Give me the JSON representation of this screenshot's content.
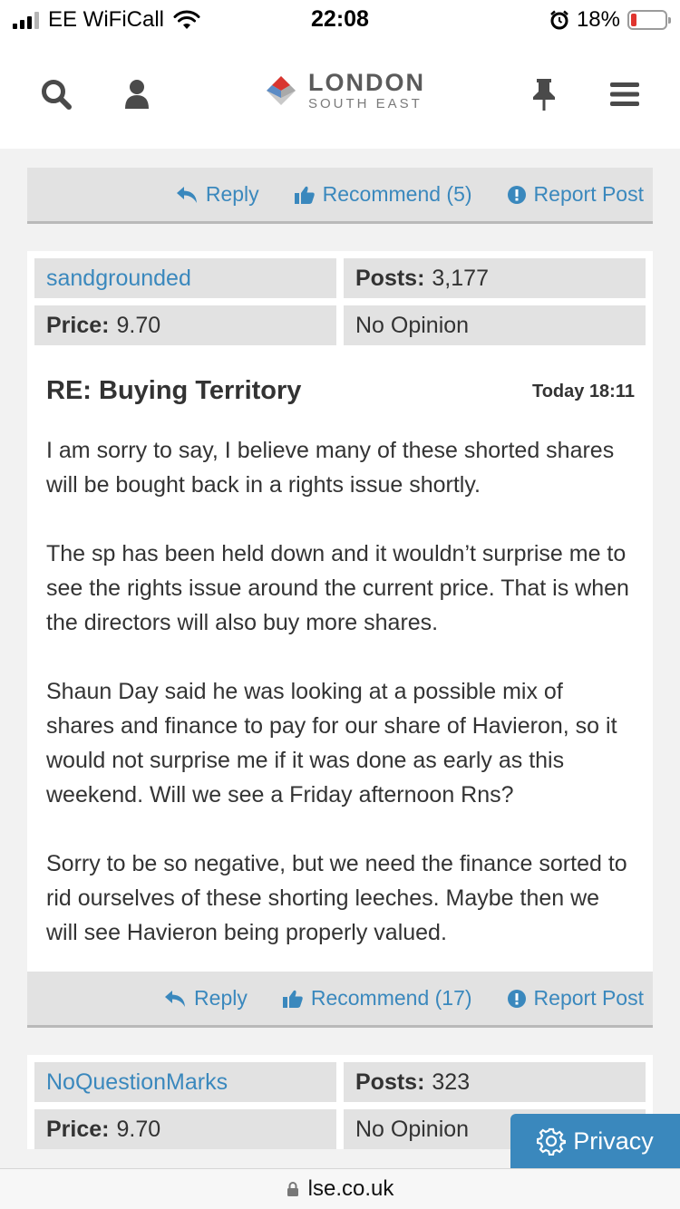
{
  "status": {
    "carrier": "EE WiFiCall",
    "time": "22:08",
    "battery": "18%",
    "battery_level": 0.18
  },
  "header": {
    "logo_main": "LONDON",
    "logo_sub": "SOUTH EAST",
    "icons": [
      "search-icon",
      "user-icon",
      "pin-icon",
      "menu-icon"
    ]
  },
  "actions_top": {
    "reply": "Reply",
    "recommend": "Recommend (5)",
    "report": "Report Post"
  },
  "post": {
    "author": "sandgrounded",
    "posts_label": "Posts:",
    "posts_value": "3,177",
    "price_label": "Price:",
    "price_value": "9.70",
    "opinion": "No Opinion",
    "title": "RE: Buying Territory",
    "time": "Today 18:11",
    "paragraphs": [
      "I am sorry to say, I believe many of these shorted shares will be bought back in a rights issue shortly.",
      "The sp has been held down and it wouldn’t surprise me to see the rights issue around the current price. That is when the directors will also buy more shares.",
      "Shaun Day said he was looking at a possible mix of shares and finance to pay for our share of Havieron, so it would not surprise me if it was done as early as this weekend. Will we see a Friday afternoon Rns?",
      "Sorry to be so negative, but we need the finance sorted to rid ourselves of these shorting leeches. Maybe then we will see Havieron being properly valued."
    ]
  },
  "actions_post": {
    "reply": "Reply",
    "recommend": "Recommend (17)",
    "report": "Report Post"
  },
  "post2": {
    "author": "NoQuestionMarks",
    "posts_label": "Posts:",
    "posts_value": "323",
    "price_label": "Price:",
    "price_value": "9.70",
    "opinion": "No Opinion"
  },
  "privacy_label": "Privacy",
  "url": "lse.co.uk",
  "colors": {
    "link": "#3a88bd",
    "bar": "#e2e2e2",
    "page": "#f2f2f2"
  }
}
